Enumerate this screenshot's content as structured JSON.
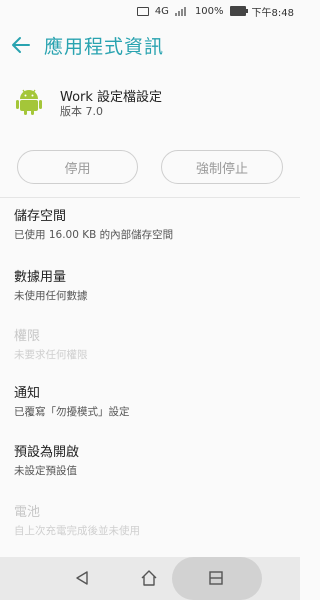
{
  "status_bar": {
    "network": "4G",
    "battery": "100%",
    "time": "下午8:48",
    "battery_level": 1.0
  },
  "app_bar": {
    "title": "應用程式資訊",
    "back_icon": "arrow-left-icon",
    "accent_color": "#29a3b0"
  },
  "app": {
    "name": "Work 設定檔設定",
    "version": "版本 7.0",
    "icon": "android-icon",
    "icon_color": "#a4c639"
  },
  "actions": {
    "disable_label": "停用",
    "force_stop_label": "強制停止"
  },
  "settings": [
    {
      "title": "儲存空間",
      "summary": "已使用 16.00 KB 的內部儲存空間",
      "enabled": true
    },
    {
      "title": "數據用量",
      "summary": "未使用任何數據",
      "enabled": true
    },
    {
      "title": "權限",
      "summary": "未要求任何權限",
      "enabled": false
    },
    {
      "title": "通知",
      "summary": "已覆寫「勿擾模式」設定",
      "enabled": true
    },
    {
      "title": "預設為開啟",
      "summary": "未設定預設值",
      "enabled": true
    },
    {
      "title": "電池",
      "summary": "自上次充電完成後並未使用",
      "enabled": false
    }
  ],
  "nav_bar": {
    "back_icon": "nav-back-icon",
    "home_icon": "nav-home-icon",
    "recents_icon": "nav-recents-icon"
  }
}
